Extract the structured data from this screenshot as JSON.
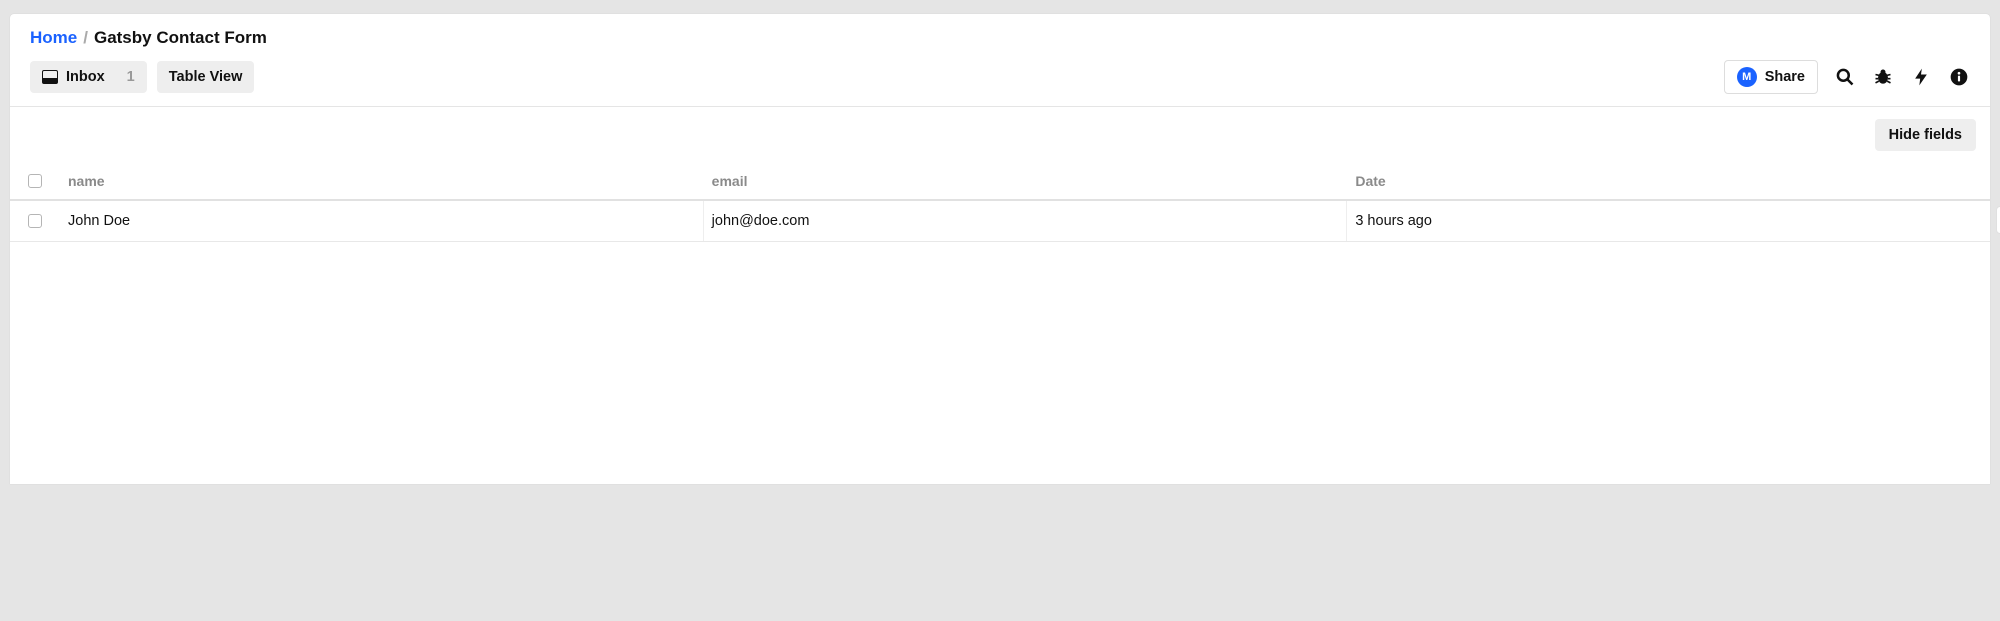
{
  "breadcrumb": {
    "home": "Home",
    "sep": "/",
    "current": "Gatsby Contact Form"
  },
  "toolbar": {
    "inbox_label": "Inbox",
    "inbox_count": "1",
    "tableview_label": "Table View",
    "share_label": "Share",
    "share_avatar_letter": "M",
    "hide_fields_label": "Hide fields"
  },
  "table": {
    "columns": {
      "name": "name",
      "email": "email",
      "date": "Date"
    },
    "rows": [
      {
        "name": "John Doe",
        "email": "john@doe.com",
        "date": "3 hours ago"
      }
    ]
  }
}
